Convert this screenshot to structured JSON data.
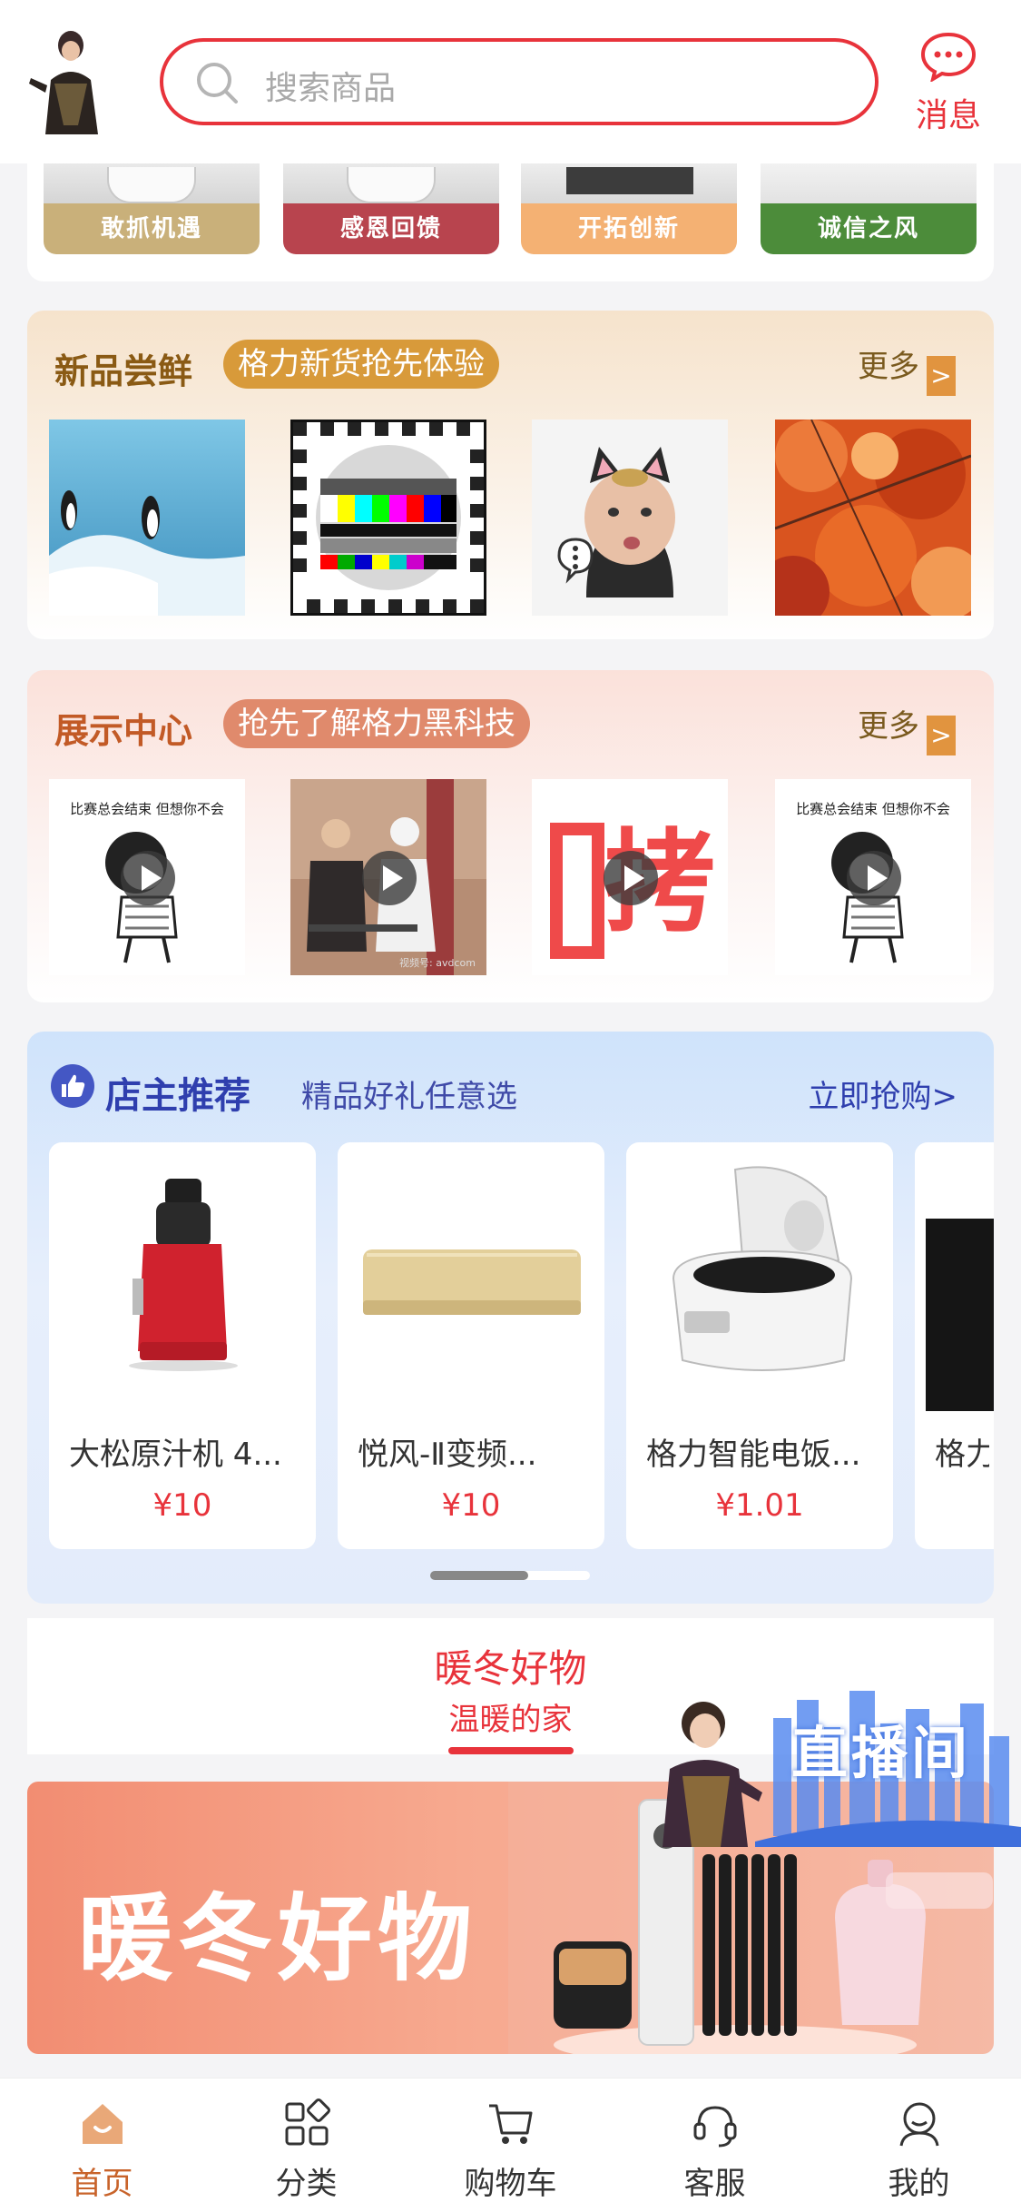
{
  "header": {
    "search_placeholder": "搜索商品",
    "message_label": "消息"
  },
  "culture": {
    "tiles": [
      {
        "label": "敢抓机遇",
        "color": "#c9b07a"
      },
      {
        "label": "感恩回馈",
        "color": "#b8444e"
      },
      {
        "label": "开拓创新",
        "color": "#f4b173"
      },
      {
        "label": "诚信之风",
        "color": "#4c8c3a"
      }
    ]
  },
  "new_products": {
    "title": "新品尝鲜",
    "tag": "格力新货抢先体验",
    "more": "更多"
  },
  "showcase": {
    "title": "展示中心",
    "tag": "抢先了解格力黑科技",
    "more": "更多",
    "video_caption": "比赛总会结束  但想你不会",
    "video_text": "拷贝",
    "video_watermark": "视频号: avdcom"
  },
  "recommend": {
    "title": "店主推荐",
    "subtitle": "精品好礼任意选",
    "more": "立即抢购>",
    "products": [
      {
        "name": "大松原汁机 4...",
        "price": "¥10"
      },
      {
        "name": "悦风-Ⅱ变频...",
        "price": "¥10"
      },
      {
        "name": "格力智能电饭...",
        "price": "¥1.01"
      },
      {
        "name": "格力",
        "price": ""
      }
    ]
  },
  "warm": {
    "title": "暖冬好物",
    "subtitle": "温暖的家",
    "banner_text": "暖冬好物"
  },
  "live": {
    "label": "直播间"
  },
  "tabbar": {
    "items": [
      {
        "label": "首页"
      },
      {
        "label": "分类"
      },
      {
        "label": "购物车"
      },
      {
        "label": "客服"
      },
      {
        "label": "我的"
      }
    ]
  },
  "colors": {
    "accent": "#e8333b",
    "tab_active": "#c8632a",
    "recommend_blue": "#2f3fae",
    "tag_gold": "#d89a3a",
    "tag_coral": "#e08a6c"
  }
}
